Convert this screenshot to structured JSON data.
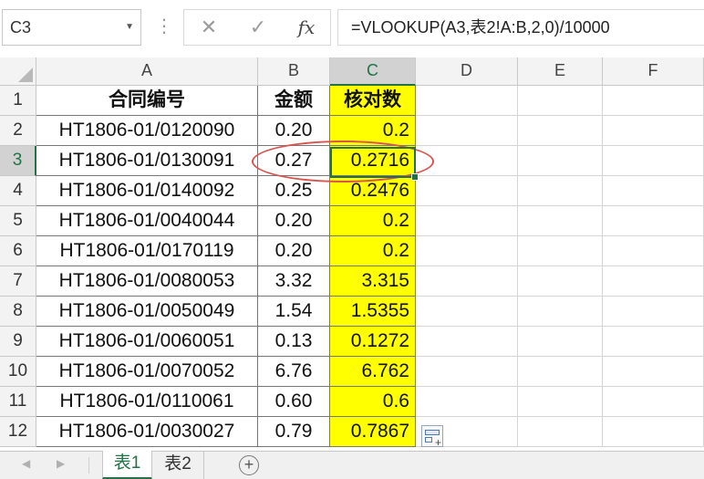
{
  "formula_bar": {
    "name_box": "C3",
    "cancel_icon": "✕",
    "enter_icon": "✓",
    "insert_function_icon": "fx",
    "formula": "=VLOOKUP(A3,表2!A:B,2,0)/10000"
  },
  "columns": [
    "A",
    "B",
    "C",
    "D",
    "E",
    "F"
  ],
  "row_numbers": [
    "1",
    "2",
    "3",
    "4",
    "5",
    "6",
    "7",
    "8",
    "9",
    "10",
    "11",
    "12"
  ],
  "header_row": {
    "a": "合同编号",
    "b": "金额",
    "c": "核对数"
  },
  "rows": [
    {
      "a": "HT1806-01/0120090",
      "b": "0.20",
      "c": "0.2"
    },
    {
      "a": "HT1806-01/0130091",
      "b": "0.27",
      "c": "0.2716"
    },
    {
      "a": "HT1806-01/0140092",
      "b": "0.25",
      "c": "0.2476"
    },
    {
      "a": "HT1806-01/0040044",
      "b": "0.20",
      "c": "0.2"
    },
    {
      "a": "HT1806-01/0170119",
      "b": "0.20",
      "c": "0.2"
    },
    {
      "a": "HT1806-01/0080053",
      "b": "3.32",
      "c": "3.315"
    },
    {
      "a": "HT1806-01/0050049",
      "b": "1.54",
      "c": "1.5355"
    },
    {
      "a": "HT1806-01/0060051",
      "b": "0.13",
      "c": "0.1272"
    },
    {
      "a": "HT1806-01/0070052",
      "b": "6.76",
      "c": "6.762"
    },
    {
      "a": "HT1806-01/0110061",
      "b": "0.60",
      "c": "0.6"
    },
    {
      "a": "HT1806-01/0030027",
      "b": "0.79",
      "c": "0.7867"
    }
  ],
  "sheet_tabs": {
    "active": "表1",
    "second": "表2",
    "add": "+"
  },
  "colors": {
    "highlight": "#ffff00",
    "selection": "#217346",
    "annotation": "#d9534f"
  }
}
